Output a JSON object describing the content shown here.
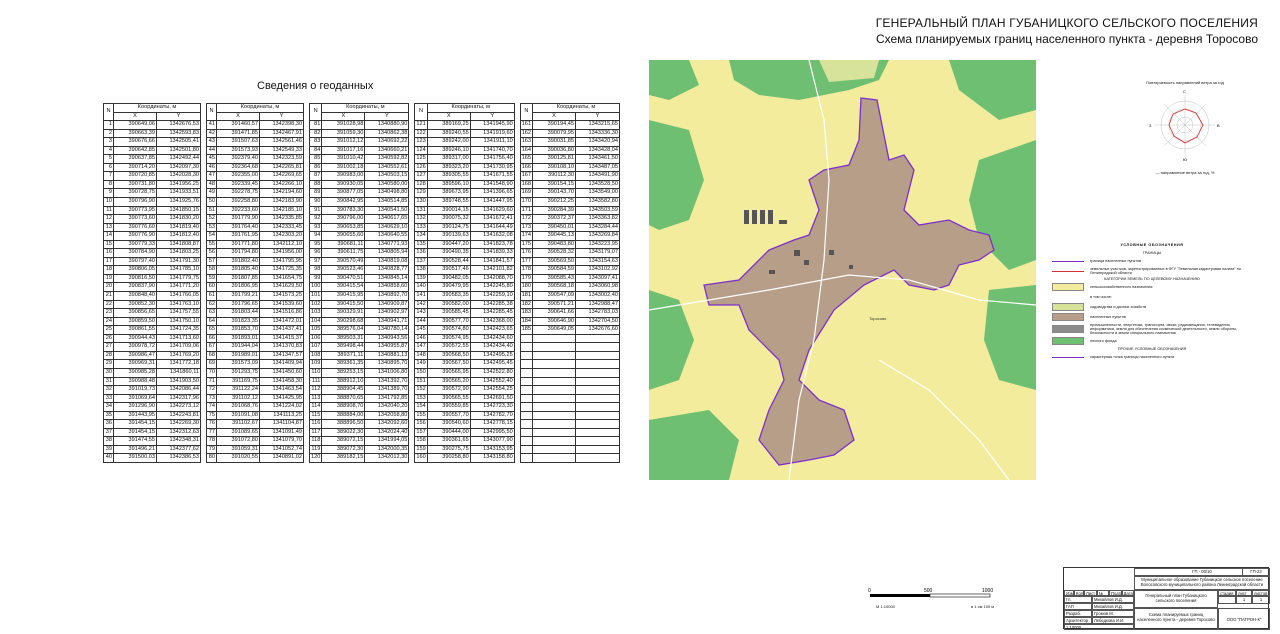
{
  "header": {
    "title": "ГЕНЕРАЛЬНЫЙ ПЛАН ГУБАНИЦКОГО СЕЛЬСКОГО ПОСЕЛЕНИЯ",
    "subtitle": "Схема планируемых границ населенного пункта - деревня Торосово"
  },
  "geodata": {
    "title": "Сведения о геоданных",
    "col_n": "N",
    "col_coords": "Координаты, м",
    "col_x": "X",
    "col_y": "Y",
    "rows": [
      [
        "1",
        "390649,06",
        "1342676,53",
        "41",
        "391460,57",
        "1342398,30",
        "81",
        "391028,98",
        "1340880,90",
        "121",
        "389169,25",
        "1341945,90",
        "161",
        "390194,45",
        "1343215,65"
      ],
      [
        "2",
        "390663,39",
        "1342593,83",
        "42",
        "391471,85",
        "1342467,91",
        "82",
        "391059,30",
        "1340862,38",
        "122",
        "389240,55",
        "1341919,60",
        "162",
        "390079,95",
        "1343336,30"
      ],
      [
        "3",
        "390676,66",
        "1342505,41",
        "43",
        "391507,63",
        "1342561,46",
        "83",
        "391012,12",
        "1340692,22",
        "123",
        "389242,00",
        "1341911,10",
        "163",
        "390031,85",
        "1343420,94"
      ],
      [
        "4",
        "390642,85",
        "1342501,80",
        "44",
        "391573,93",
        "1342549,33",
        "84",
        "391017,16",
        "1340660,21",
        "124",
        "389246,10",
        "1341740,70",
        "164",
        "390036,80",
        "1343428,04"
      ],
      [
        "5",
        "390637,85",
        "1342492,44",
        "45",
        "392379,40",
        "1342323,59",
        "85",
        "391010,42",
        "1340592,82",
        "125",
        "389317,00",
        "1341756,40",
        "165",
        "390125,81",
        "1343461,50"
      ],
      [
        "6",
        "390714,20",
        "1342097,30",
        "46",
        "392364,68",
        "1342265,81",
        "86",
        "391002,18",
        "1340552,61",
        "126",
        "389323,20",
        "1341730,95",
        "166",
        "390108,10",
        "1343487,05"
      ],
      [
        "7",
        "390720,85",
        "1342028,30",
        "47",
        "392355,00",
        "1342269,65",
        "87",
        "390983,00",
        "1340503,15",
        "127",
        "389305,55",
        "1341671,55",
        "167",
        "390112,30",
        "1343491,90"
      ],
      [
        "8",
        "390731,80",
        "1341956,25",
        "48",
        "392339,45",
        "1342266,10",
        "88",
        "390930,05",
        "1340580,00",
        "128",
        "389596,10",
        "1341548,90",
        "168",
        "390154,15",
        "1343528,50"
      ],
      [
        "9",
        "390728,75",
        "1341933,51",
        "49",
        "392278,75",
        "1342194,60",
        "89",
        "390877,05",
        "1340498,80",
        "129",
        "389673,95",
        "1341396,65",
        "169",
        "390143,70",
        "1343549,00"
      ],
      [
        "10",
        "390796,90",
        "1341925,76",
        "50",
        "392258,80",
        "1342183,90",
        "90",
        "390842,95",
        "1340514,85",
        "130",
        "389748,55",
        "1341447,95",
        "170",
        "390212,25",
        "1343582,80"
      ],
      [
        "11",
        "390773,95",
        "1341850,15",
        "51",
        "392233,60",
        "1342185,10",
        "91",
        "390783,30",
        "1340541,50",
        "131",
        "390014,15",
        "1341629,60",
        "171",
        "390284,39",
        "1343503,59"
      ],
      [
        "12",
        "390773,60",
        "1341830,20",
        "52",
        "391779,90",
        "1342335,85",
        "92",
        "390796,00",
        "1340617,65",
        "132",
        "390075,32",
        "1341672,41",
        "172",
        "390372,37",
        "1343363,82"
      ],
      [
        "13",
        "390776,60",
        "1341819,40",
        "53",
        "391764,40",
        "1342333,45",
        "93",
        "390653,85",
        "1340629,10",
        "133",
        "390124,75",
        "1341644,49",
        "173",
        "390450,01",
        "1343284,44"
      ],
      [
        "14",
        "390776,90",
        "1341812,40",
        "54",
        "391761,95",
        "1342303,20",
        "94",
        "390655,60",
        "1340640,55",
        "134",
        "390139,63",
        "1341632,08",
        "174",
        "390445,13",
        "1343269,84"
      ],
      [
        "15",
        "390779,33",
        "1341808,87",
        "55",
        "391771,80",
        "1342112,10",
        "95",
        "390681,11",
        "1340771,93",
        "135",
        "390447,20",
        "1341823,78",
        "175",
        "390483,80",
        "1343223,95"
      ],
      [
        "16",
        "390784,90",
        "1341803,25",
        "56",
        "391794,80",
        "1341956,00",
        "96",
        "390611,75",
        "1340805,94",
        "136",
        "390490,35",
        "1341839,33",
        "176",
        "390528,32",
        "1343179,07"
      ],
      [
        "17",
        "390797,40",
        "1341791,30",
        "57",
        "391802,40",
        "1341795,95",
        "97",
        "390570,49",
        "1340819,08",
        "137",
        "390528,44",
        "1341841,57",
        "177",
        "390569,50",
        "1343154,63"
      ],
      [
        "18",
        "390806,05",
        "1341785,10",
        "58",
        "391805,40",
        "1341725,35",
        "98",
        "390523,46",
        "1340828,77",
        "138",
        "390517,46",
        "1342101,82",
        "178",
        "390584,59",
        "1343102,92"
      ],
      [
        "19",
        "390816,50",
        "1341779,75",
        "59",
        "391807,85",
        "1341654,75",
        "99",
        "390470,51",
        "1340845,14",
        "139",
        "390482,05",
        "1342088,70",
        "179",
        "390585,43",
        "1343097,41"
      ],
      [
        "20",
        "390837,90",
        "1341771,20",
        "60",
        "391806,95",
        "1341629,50",
        "100",
        "390415,54",
        "1340858,60",
        "140",
        "390479,95",
        "1342245,80",
        "180",
        "390568,18",
        "1343060,98"
      ],
      [
        "21",
        "390848,40",
        "1341766,05",
        "61",
        "391799,21",
        "1341573,25",
        "101",
        "390415,95",
        "1340892,70",
        "141",
        "390583,35",
        "1342259,10",
        "181",
        "390547,09",
        "1343002,40"
      ],
      [
        "22",
        "390852,30",
        "1341763,10",
        "62",
        "391796,65",
        "1341539,60",
        "102",
        "390415,50",
        "1340909,87",
        "142",
        "390582,00",
        "1342285,38",
        "182",
        "390571,21",
        "1342988,47"
      ],
      [
        "23",
        "390856,65",
        "1341757,55",
        "63",
        "391803,44",
        "1341516,86",
        "103",
        "390329,91",
        "1340902,97",
        "143",
        "390585,45",
        "1342285,45",
        "183",
        "390641,66",
        "1342783,03"
      ],
      [
        "24",
        "390859,50",
        "1341750,10",
        "64",
        "391823,35",
        "1341472,01",
        "104",
        "390298,68",
        "1340941,71",
        "144",
        "390577,70",
        "1342368,00",
        "184",
        "390646,90",
        "1342704,50"
      ],
      [
        "25",
        "390861,55",
        "1341724,35",
        "65",
        "391853,70",
        "1341437,41",
        "105",
        "389576,04",
        "1340780,14",
        "145",
        "390574,80",
        "1342423,65",
        "185",
        "390649,05",
        "1342676,60"
      ],
      [
        "26",
        "390944,43",
        "1341713,60",
        "66",
        "391893,01",
        "1341415,37",
        "106",
        "389503,31",
        "1340943,56",
        "146",
        "390574,95",
        "1342434,60",
        "",
        "",
        ""
      ],
      [
        "27",
        "390978,72",
        "1341709,06",
        "67",
        "391944,04",
        "1341370,83",
        "107",
        "389498,44",
        "1340955,87",
        "147",
        "390572,55",
        "1342434,40",
        "",
        "",
        ""
      ],
      [
        "28",
        "390986,47",
        "1341769,20",
        "68",
        "391989,01",
        "1341347,57",
        "108",
        "389371,11",
        "1340881,13",
        "148",
        "390568,50",
        "1342495,25",
        "",
        "",
        ""
      ],
      [
        "29",
        "390969,31",
        "1341772,18",
        "69",
        "391573,09",
        "1341409,94",
        "109",
        "389361,35",
        "1340895,70",
        "149",
        "390567,50",
        "1342495,45",
        "",
        "",
        ""
      ],
      [
        "30",
        "390985,28",
        "1341860,11",
        "70",
        "391293,75",
        "1341450,60",
        "110",
        "389253,15",
        "1341006,80",
        "150",
        "390565,95",
        "1342522,80",
        "",
        "",
        ""
      ],
      [
        "31",
        "390988,48",
        "1341903,50",
        "71",
        "391169,75",
        "1341458,30",
        "111",
        "388912,10",
        "1341392,70",
        "151",
        "390565,20",
        "1342552,40",
        "",
        "",
        ""
      ],
      [
        "32",
        "391019,73",
        "1342086,44",
        "72",
        "391122,24",
        "1341463,54",
        "112",
        "388904,45",
        "1341389,70",
        "152",
        "390572,90",
        "1342554,25",
        "",
        "",
        ""
      ],
      [
        "33",
        "391069,64",
        "1342317,96",
        "73",
        "391102,12",
        "1341425,95",
        "113",
        "388870,65",
        "1341792,85",
        "153",
        "390565,55",
        "1342691,50",
        "",
        "",
        ""
      ],
      [
        "34",
        "391296,90",
        "1342273,12",
        "74",
        "391068,76",
        "1341224,02",
        "114",
        "388908,70",
        "1342040,20",
        "154",
        "390559,85",
        "1342723,30",
        "",
        "",
        ""
      ],
      [
        "35",
        "391443,95",
        "1342243,81",
        "75",
        "391091,08",
        "1341113,25",
        "115",
        "388884,00",
        "1342058,80",
        "155",
        "390557,70",
        "1342782,70",
        "",
        "",
        ""
      ],
      [
        "36",
        "391454,15",
        "1342269,30",
        "76",
        "391102,67",
        "1341104,87",
        "116",
        "388896,50",
        "1342092,60",
        "156",
        "390540,60",
        "1342778,15",
        "",
        "",
        ""
      ],
      [
        "37",
        "391454,15",
        "1342312,63",
        "77",
        "391089,65",
        "1341091,49",
        "117",
        "389022,30",
        "1342024,40",
        "157",
        "390444,00",
        "1342995,50",
        "",
        "",
        ""
      ],
      [
        "38",
        "391474,55",
        "1342348,31",
        "78",
        "391072,80",
        "1341079,70",
        "118",
        "389072,15",
        "1341994,05",
        "158",
        "390361,65",
        "1343077,90",
        "",
        "",
        ""
      ],
      [
        "39",
        "391496,21",
        "1342377,62",
        "79",
        "391059,31",
        "1341052,74",
        "119",
        "389072,30",
        "1342000,35",
        "159",
        "390275,75",
        "1343153,95",
        "",
        "",
        ""
      ],
      [
        "40",
        "391500,03",
        "1342386,53",
        "80",
        "391020,55",
        "1340891,02",
        "120",
        "389182,15",
        "1342012,30",
        "160",
        "390258,80",
        "1343158,80",
        "",
        "",
        ""
      ]
    ]
  },
  "map": {
    "label_town": "Торосово",
    "colors": {
      "base": "#f3ec9d",
      "forest": "#6fbf73",
      "settlement": "#b79e88",
      "boundary": "#7d2ed0",
      "roads": "#ffffff",
      "agri": "#d7e39a"
    }
  },
  "wind": {
    "title": "Повторяемость направлений ветра за год",
    "note": "— направление ветра за год, %",
    "n": "С",
    "s": "Ю",
    "e": "В",
    "w": "З"
  },
  "legend": {
    "title": "УСЛОВНЫЕ ОБОЗНАЧЕНИЯ",
    "subtitle_borders": "ГРАНИЦЫ",
    "items_borders": [
      {
        "label": "граница населенных пунктов",
        "kind": "line",
        "color": "#7d2ed0"
      },
      {
        "label": "земельных участков, зарегистрированных в ФГУ \"Земельная кадастровая палата\" по Ленинградской области",
        "kind": "line",
        "color": "#c33"
      }
    ],
    "subtitle_categories": "КАТЕГОРИИ ЗЕМЕЛЬ ПО ЦЕЛЕВОМУ НАЗНАЧЕНИЮ",
    "items_categories": [
      {
        "label": "сельскохозяйственного назначения",
        "color": "#f3ec9d"
      },
      {
        "label": "в том числе:",
        "color": ""
      },
      {
        "label": "садоводства и дачных хозяйств",
        "color": "#d7e39a"
      },
      {
        "label": "населенных пунктов",
        "color": "#b79e88"
      },
      {
        "label": "промышленности, энергетики, транспорта, связи, радиовещания, телевидения, информатики, земли для обеспечения космической деятельности, земли обороны, безопасности и земли специального назначения",
        "color": "#8c8c8c"
      },
      {
        "label": "лесного фонда",
        "color": "#6fbf73"
      }
    ],
    "subtitle_other": "ПРОЧИЕ УСЛОВНЫЕ ОБОЗНАЧЕНИЯ",
    "items_other": [
      {
        "label": "характерная точка границы населенного пункта",
        "kind": "point"
      }
    ]
  },
  "scale": {
    "ticks": [
      "0",
      "500",
      "1000"
    ],
    "left_note": "М 1:10000",
    "right_note": "в 1 см 100 м"
  },
  "stamp": {
    "code": "ГП - 00/10",
    "sheet_code": "ГП-23",
    "org": "Муниципальное образование Губаницкое сельское поселение Волосовского муниципального района Ленинградской области",
    "project": "Генеральный план Губаницкого сельского поселения",
    "sheet_title": "Схема планируемых границ населенного пункта - деревня Торосово",
    "stage": "стадия",
    "list": "лист",
    "lists": "листов",
    "stage_val": "",
    "list_val": "1",
    "lists_val": "1",
    "hdr_cols": [
      "Изм.",
      "Кол.уч.",
      "Лист",
      "№ док.",
      "Подп.",
      "Дата"
    ],
    "roles": [
      "Гл. архитектор",
      "ГАП",
      "Разраб.",
      "Архитектор"
    ],
    "names": [
      "Михайлов И.Д.",
      "Михайлов И.Д.",
      "Громов М.",
      "Лебедкова И.И."
    ],
    "company": "ООО \"ПАТРОН-К\"",
    "bottom_note": "1:10000"
  }
}
